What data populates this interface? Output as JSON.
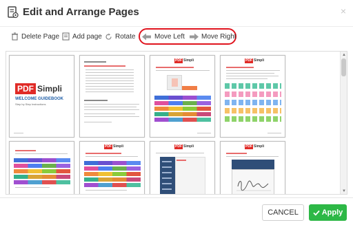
{
  "dialog": {
    "title": "Edit and Arrange Pages",
    "close_label": "×"
  },
  "toolbar": {
    "delete_label": "Delete Page",
    "add_label": "Add page",
    "rotate_label": "Rotate",
    "move_left_label": "Move Left",
    "move_right_label": "Move Right"
  },
  "cover": {
    "logo_pdf": "PDF",
    "logo_simpli": "Simpli",
    "heading": "WELCOME GUIDEBOOK",
    "subheading": "Step by Step Instructions"
  },
  "pages": [
    {
      "id": 1,
      "kind": "cover"
    },
    {
      "id": 2,
      "kind": "toc"
    },
    {
      "id": 3,
      "kind": "tiles"
    },
    {
      "id": 4,
      "kind": "icons"
    },
    {
      "id": 5,
      "kind": "tiles"
    },
    {
      "id": 6,
      "kind": "tiles"
    },
    {
      "id": 7,
      "kind": "sidebar"
    },
    {
      "id": 8,
      "kind": "signature"
    }
  ],
  "footer": {
    "cancel_label": "CANCEL",
    "apply_label": "Apply"
  },
  "colors": {
    "highlight": "#e0131d",
    "apply": "#2db846",
    "brand_red": "#e02b27"
  }
}
